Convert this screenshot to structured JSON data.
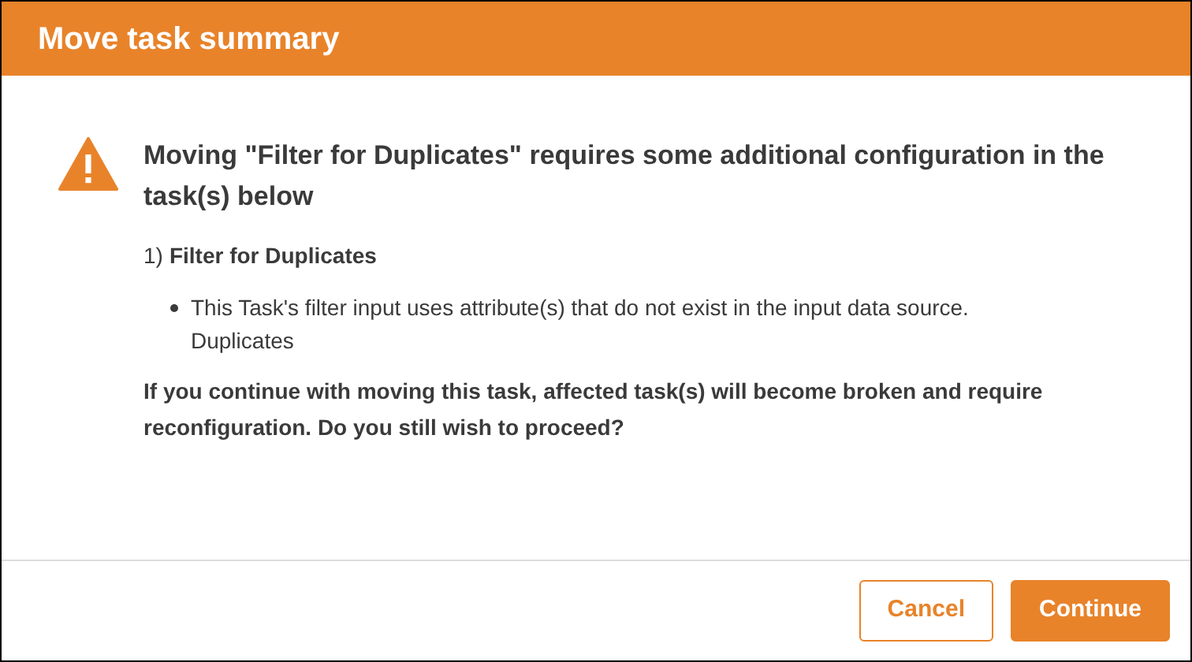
{
  "dialog": {
    "title": "Move task summary"
  },
  "message": {
    "heading": "Moving \"Filter for Duplicates\" requires some additional configuration in the task(s) below",
    "tasks": [
      {
        "number": "1)",
        "name": "Filter for Duplicates",
        "issues": [
          {
            "text": "This Task's filter input uses attribute(s) that do not exist in the input data source.",
            "detail": "Duplicates"
          }
        ]
      }
    ],
    "warning": "If you continue with moving this task, affected task(s) will become broken and require reconfiguration. Do you still wish to proceed?"
  },
  "buttons": [
    {
      "label": "Cancel",
      "kind": "secondary"
    },
    {
      "label": "Continue",
      "kind": "primary"
    }
  ]
}
